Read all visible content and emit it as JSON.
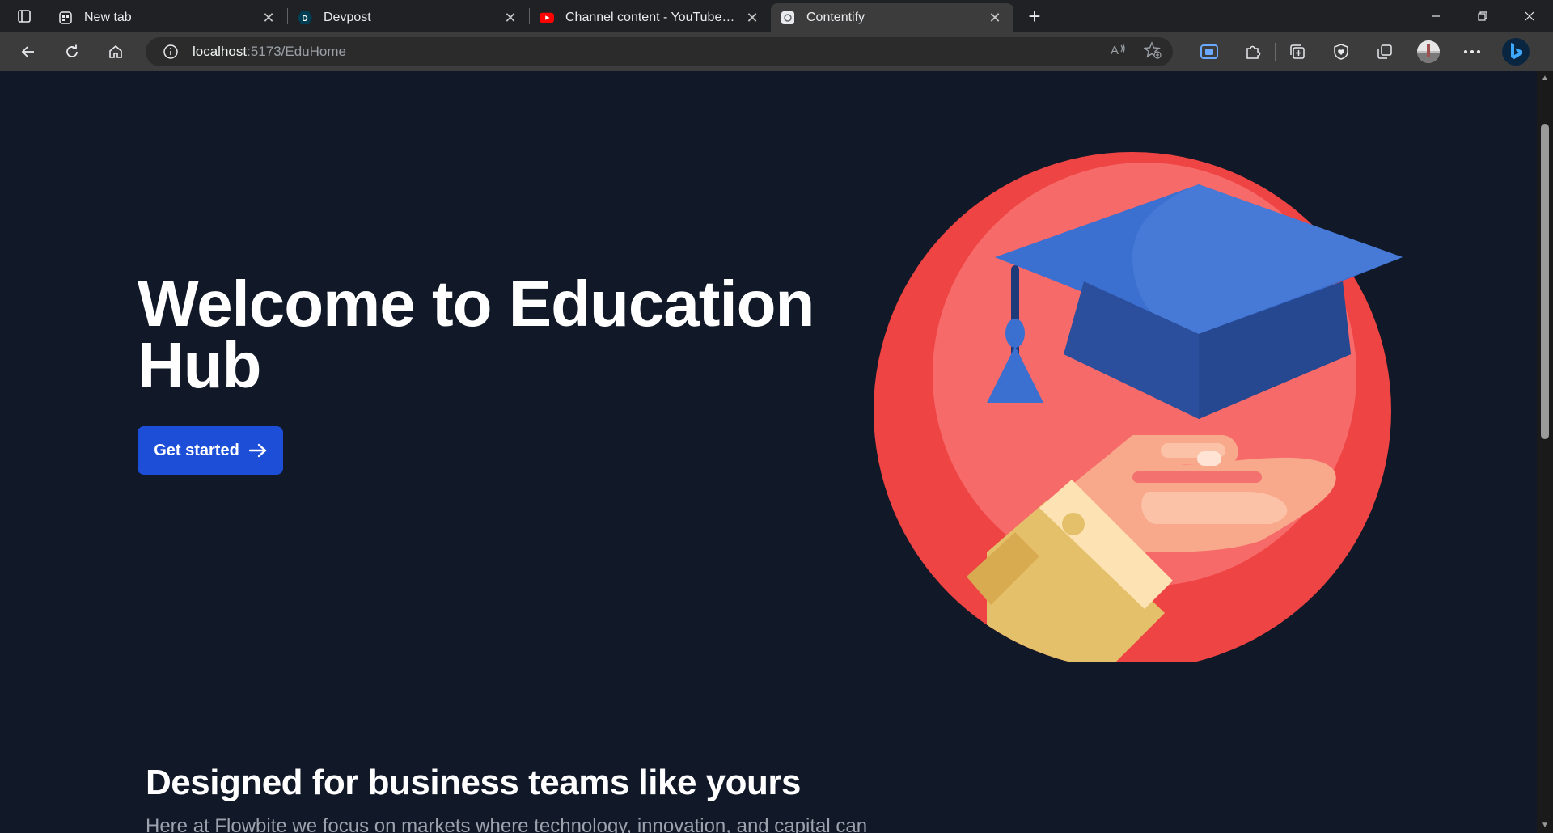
{
  "browser": {
    "tabs": [
      {
        "title": "New tab",
        "icon": "new-tab-page-icon"
      },
      {
        "title": "Devpost",
        "icon": "devpost-icon"
      },
      {
        "title": "Channel content - YouTube Studio",
        "icon": "youtube-icon"
      },
      {
        "title": "Contentify",
        "icon": "contentify-icon"
      }
    ],
    "active_tab": 3,
    "address_bar": {
      "host": "localhost",
      "path": ":5173/EduHome"
    }
  },
  "hero": {
    "title": "Welcome to Education Hub",
    "cta_label": "Get started",
    "image": "graduation-cap-hand-illustration"
  },
  "section": {
    "title": "Designed for business teams like yours",
    "text": "Here at Flowbite we focus on markets where technology, innovation, and capital can"
  },
  "colors": {
    "page_background": "#111827",
    "cta_background": "#1d4ed8",
    "illustration_circle": "#ef4444",
    "cap_blue": "#3b6fd0"
  }
}
